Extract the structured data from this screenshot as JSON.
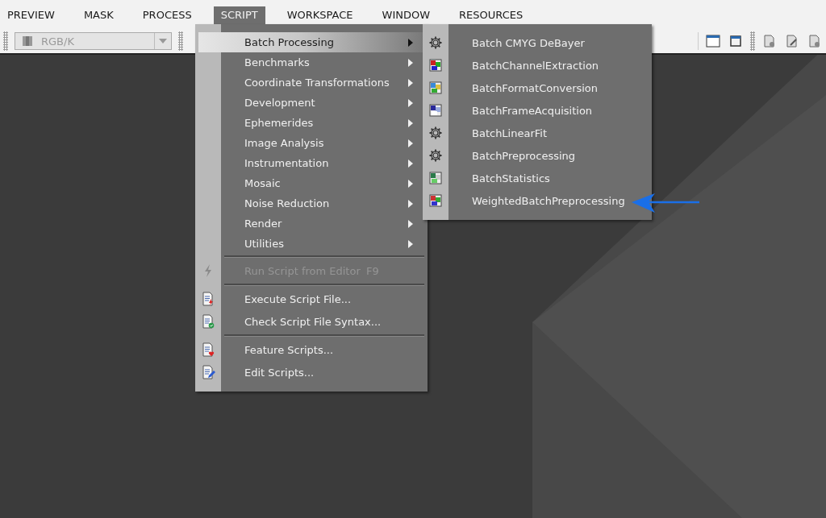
{
  "menubar": [
    {
      "label": "PREVIEW",
      "selected": false
    },
    {
      "label": "MASK",
      "selected": false
    },
    {
      "label": "PROCESS",
      "selected": false
    },
    {
      "label": "SCRIPT",
      "selected": true
    },
    {
      "label": "WORKSPACE",
      "selected": false
    },
    {
      "label": "WINDOW",
      "selected": false
    },
    {
      "label": "RESOURCES",
      "selected": false
    }
  ],
  "toolbar": {
    "color_mode": {
      "value": "RGB/K",
      "disabled": true
    }
  },
  "script_menu": [
    {
      "kind": "submenu",
      "label": "Batch Processing",
      "selected": true
    },
    {
      "kind": "submenu",
      "label": "Benchmarks",
      "selected": false
    },
    {
      "kind": "submenu",
      "label": "Coordinate Transformations",
      "selected": false
    },
    {
      "kind": "submenu",
      "label": "Development",
      "selected": false
    },
    {
      "kind": "submenu",
      "label": "Ephemerides",
      "selected": false
    },
    {
      "kind": "submenu",
      "label": "Image Analysis",
      "selected": false
    },
    {
      "kind": "submenu",
      "label": "Instrumentation",
      "selected": false
    },
    {
      "kind": "submenu",
      "label": "Mosaic",
      "selected": false
    },
    {
      "kind": "submenu",
      "label": "Noise Reduction",
      "selected": false
    },
    {
      "kind": "submenu",
      "label": "Render",
      "selected": false
    },
    {
      "kind": "submenu",
      "label": "Utilities",
      "selected": false
    },
    {
      "kind": "separator"
    },
    {
      "kind": "action",
      "label": "Run Script from Editor",
      "shortcut": "F9",
      "disabled": true
    },
    {
      "kind": "separator"
    },
    {
      "kind": "action",
      "label": "Execute Script File...",
      "disabled": false
    },
    {
      "kind": "action",
      "label": "Check Script File Syntax...",
      "disabled": false
    },
    {
      "kind": "separator"
    },
    {
      "kind": "action",
      "label": "Feature Scripts...",
      "disabled": false
    },
    {
      "kind": "action",
      "label": "Edit Scripts...",
      "disabled": false
    }
  ],
  "batch_submenu": [
    {
      "label": "Batch CMYG DeBayer"
    },
    {
      "label": "BatchChannelExtraction"
    },
    {
      "label": "BatchFormatConversion"
    },
    {
      "label": "BatchFrameAcquisition"
    },
    {
      "label": "BatchLinearFit"
    },
    {
      "label": "BatchPreprocessing"
    },
    {
      "label": "BatchStatistics"
    },
    {
      "label": "WeightedBatchPreprocessing"
    }
  ]
}
